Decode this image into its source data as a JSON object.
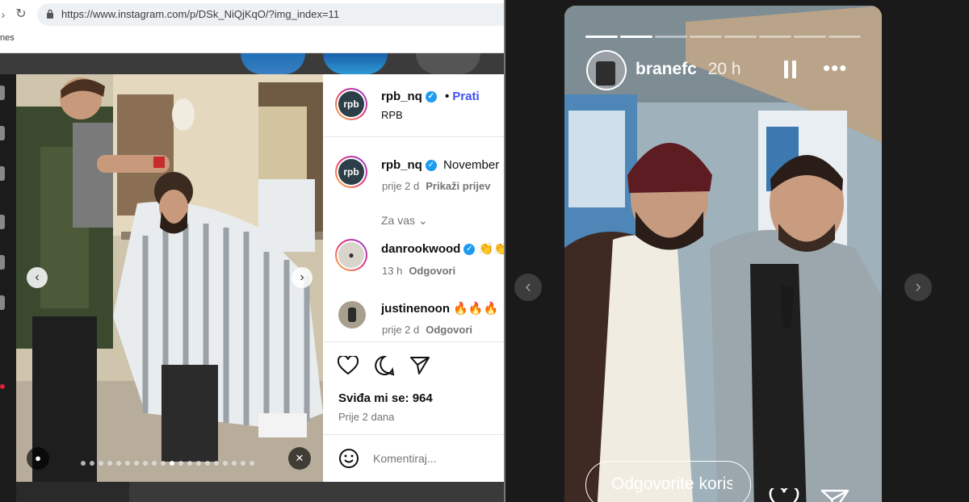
{
  "browser": {
    "url": "https://www.instagram.com/p/DSk_NiQjKqO/?img_index=11",
    "bookmark_label": "nes",
    "back_icon": "chevron-right-icon",
    "reload_icon": "reload-icon"
  },
  "post": {
    "header": {
      "username": "rpb_nq",
      "separator": "•",
      "follow_label": "Prati",
      "subtitle": "RPB",
      "avatar_text": "rpb"
    },
    "caption": {
      "username": "rpb_nq",
      "text": "November",
      "time": "prije 2 d",
      "translate_label": "Prikaži prijev"
    },
    "for_you_label": "Za vas",
    "comments": [
      {
        "username": "danrookwood",
        "text": "👏👏",
        "time": "13 h",
        "reply_label": "Odgovori"
      },
      {
        "username": "justinenoon",
        "text": "🔥🔥🔥",
        "time": "prije 2 d",
        "reply_label": "Odgovori"
      }
    ],
    "likes_label": "Sviđa mi se: 964",
    "date_label": "Prije 2 dana",
    "comment_placeholder": "Komentiraj...",
    "carousel_dots_total": 20,
    "carousel_dot_active": 10
  },
  "story": {
    "username": "branefc",
    "time": "20 h",
    "reply_placeholder": "Odgovorite korisniku",
    "progress_segments": 8,
    "progress_filled": 2,
    "icons": [
      "pause-icon",
      "more-icon",
      "heart-icon",
      "send-icon"
    ]
  },
  "colors": {
    "link_blue": "#4150f7",
    "verified": "#1d9bf0",
    "page_dark": "#1a1a1a"
  }
}
